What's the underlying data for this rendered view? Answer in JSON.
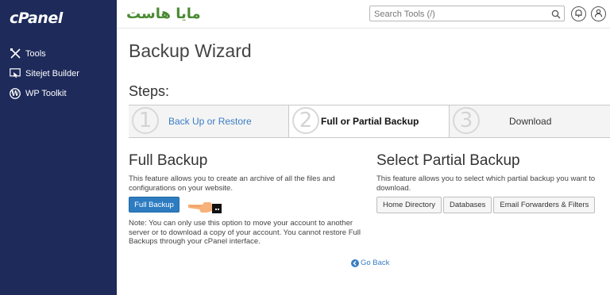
{
  "sidebar": {
    "logo": "cPanel",
    "items": [
      {
        "label": "Tools",
        "icon": "tools-icon"
      },
      {
        "label": "Sitejet Builder",
        "icon": "sitejet-icon"
      },
      {
        "label": "WP Toolkit",
        "icon": "wordpress-icon"
      }
    ]
  },
  "header": {
    "brand": "مايا هاست",
    "search_placeholder": "Search Tools (/)",
    "brand_color": "#4a8a32"
  },
  "main": {
    "title": "Backup Wizard",
    "steps_label": "Steps:",
    "steps": [
      {
        "number": "1",
        "label": "Back Up or Restore",
        "state": "link"
      },
      {
        "number": "2",
        "label": "Full or Partial Backup",
        "state": "active"
      },
      {
        "number": "3",
        "label": "Download",
        "state": "pending"
      }
    ],
    "full_backup": {
      "title": "Full Backup",
      "description": "This feature allows you to create an archive of all the files and configurations on your website.",
      "button": "Full Backup",
      "note": "Note: You can only use this option to move your account to another server or to download a copy of your account. You cannot restore Full Backups through your cPanel interface."
    },
    "partial_backup": {
      "title": "Select Partial Backup",
      "description": "This feature allows you to select which partial backup you want to download.",
      "buttons": [
        "Home Directory",
        "Databases",
        "Email Forwarders & Filters"
      ]
    },
    "go_back": "Go Back"
  },
  "colors": {
    "sidebar_bg": "#1d2a5a",
    "primary": "#2d7cc1",
    "link": "#3a7dc4"
  }
}
